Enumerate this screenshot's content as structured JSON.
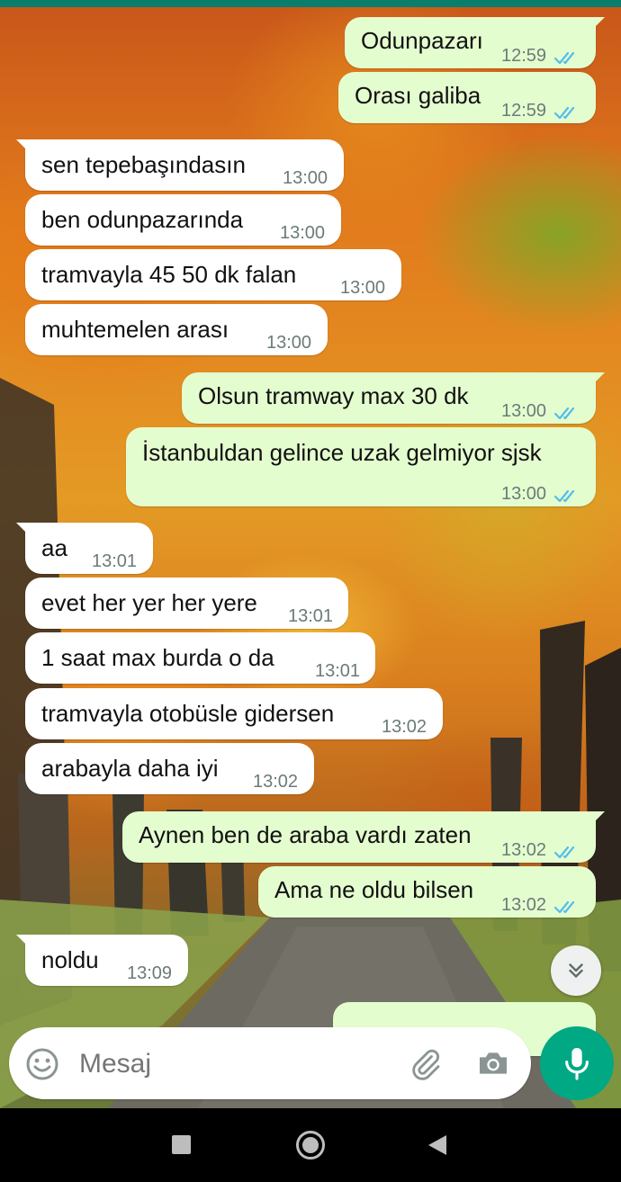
{
  "composer": {
    "placeholder": "Mesaj"
  },
  "messages": [
    {
      "direction": "out",
      "text": "Odunpazarı",
      "time": "12:59",
      "status": "read"
    },
    {
      "direction": "out",
      "text": "Orası galiba",
      "time": "12:59",
      "status": "read"
    },
    {
      "direction": "in",
      "text": "sen tepebaşındasın",
      "time": "13:00"
    },
    {
      "direction": "in",
      "text": "ben odunpazarında",
      "time": "13:00"
    },
    {
      "direction": "in",
      "text": "tramvayla 45 50 dk falan",
      "time": "13:00"
    },
    {
      "direction": "in",
      "text": "muhtemelen arası",
      "time": "13:00"
    },
    {
      "direction": "out",
      "text": "Olsun tramway max 30 dk",
      "time": "13:00",
      "status": "read"
    },
    {
      "direction": "out",
      "text": "İstanbuldan gelince uzak gelmiyor sjsk",
      "time": "13:00",
      "status": "read"
    },
    {
      "direction": "in",
      "text": "aa",
      "time": "13:01"
    },
    {
      "direction": "in",
      "text": "evet her yer her yere",
      "time": "13:01"
    },
    {
      "direction": "in",
      "text": "1 saat max burda o da",
      "time": "13:01"
    },
    {
      "direction": "in",
      "text": "tramvayla otobüsle gidersen",
      "time": "13:02"
    },
    {
      "direction": "in",
      "text": "arabayla daha iyi",
      "time": "13:02"
    },
    {
      "direction": "out",
      "text": "Aynen ben de araba vardı zaten",
      "time": "13:02",
      "status": "read"
    },
    {
      "direction": "out",
      "text": "Ama ne oldu bilsen",
      "time": "13:02",
      "status": "read"
    },
    {
      "direction": "in",
      "text": "noldu",
      "time": "13:09"
    }
  ],
  "colors": {
    "incoming_bubble": "#ffffff",
    "outgoing_bubble": "#e4fdcf",
    "read_check": "#53bdeb",
    "accent": "#00a884",
    "timestamp": "#6b7b78"
  },
  "icons": {
    "emoji": "smiley-icon",
    "attach": "paperclip-icon",
    "camera": "camera-icon",
    "mic": "microphone-icon",
    "scroll": "double-chevron-down-icon",
    "nav": [
      "recents-square-icon",
      "home-circle-icon",
      "back-triangle-icon"
    ]
  }
}
